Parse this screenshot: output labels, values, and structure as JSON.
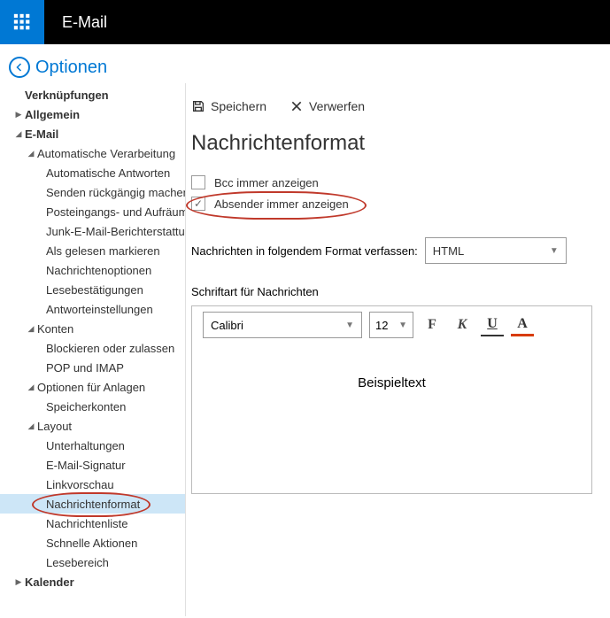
{
  "topbar": {
    "app_title": "E-Mail"
  },
  "back": {
    "label": "Optionen"
  },
  "sidebar": {
    "shortcuts": "Verknüpfungen",
    "general": "Allgemein",
    "email": "E-Mail",
    "auto": "Automatische Verarbeitung",
    "auto_items": [
      "Automatische Antworten",
      "Senden rückgängig machen",
      "Posteingangs- und Aufräumregeln",
      "Junk-E-Mail-Berichterstattung",
      "Als gelesen markieren",
      "Nachrichtenoptionen",
      "Lesebestätigungen",
      "Antworteinstellungen"
    ],
    "accounts": "Konten",
    "accounts_items": [
      "Blockieren oder zulassen",
      "POP und IMAP"
    ],
    "attach": "Optionen für Anlagen",
    "attach_items": [
      "Speicherkonten"
    ],
    "layout": "Layout",
    "layout_items": [
      "Unterhaltungen",
      "E-Mail-Signatur",
      "Linkvorschau",
      "Nachrichtenformat",
      "Nachrichtenliste",
      "Schnelle Aktionen",
      "Lesebereich"
    ],
    "calendar": "Kalender"
  },
  "toolbar": {
    "save": "Speichern",
    "discard": "Verwerfen"
  },
  "page": {
    "title": "Nachrichtenformat",
    "bcc_label": "Bcc immer anzeigen",
    "sender_label": "Absender immer anzeigen",
    "format_label": "Nachrichten in folgendem Format verfassen:",
    "format_value": "HTML",
    "font_label": "Schriftart für Nachrichten",
    "font_name": "Calibri",
    "font_size": "12",
    "preview": "Beispieltext",
    "fmt_b": "F",
    "fmt_i": "K",
    "fmt_u": "U",
    "fmt_a": "A"
  }
}
